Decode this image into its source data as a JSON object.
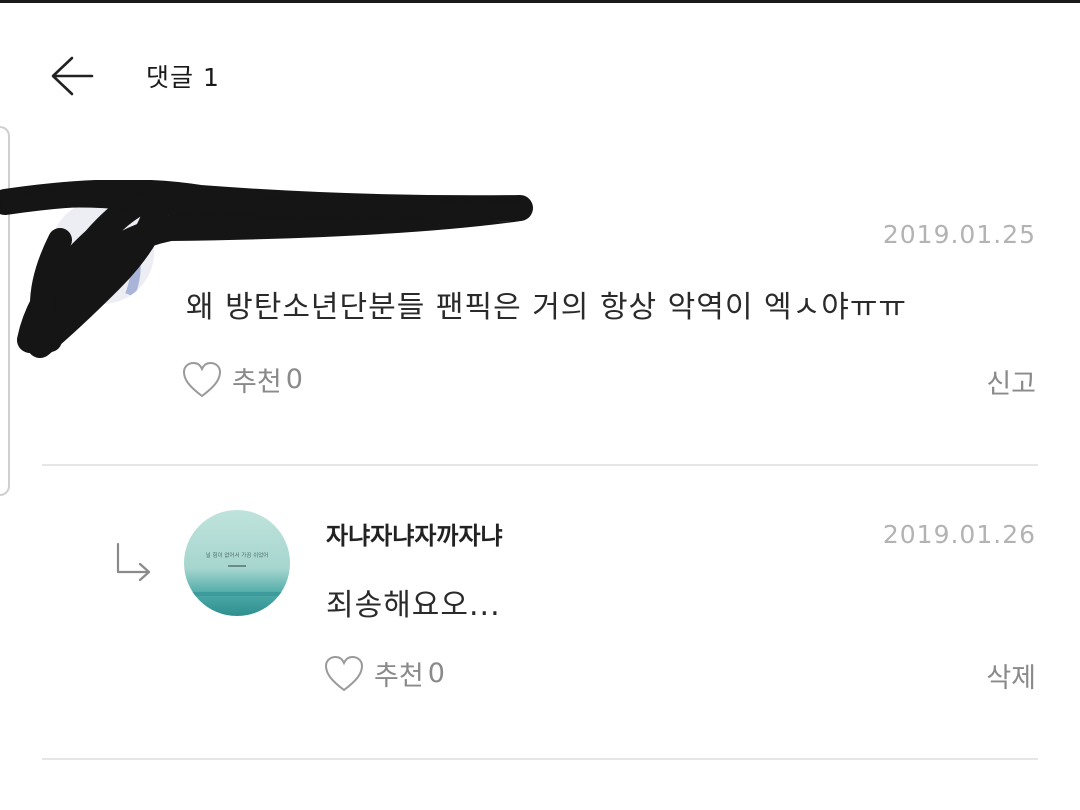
{
  "header": {
    "title": "댓글 1",
    "back_icon": "arrow-left-icon"
  },
  "comments": [
    {
      "author": "",
      "date": "2019.01.25",
      "text": "왜 방탄소년단분들 팬픽은 거의 항상 악역이 엑ㅅ야ㅠㅠ",
      "like_label": "추천",
      "like_count": "0",
      "action_label": "신고"
    }
  ],
  "reply": {
    "author": "자냐자냐자까자냐",
    "date": "2019.01.26",
    "text": "죄송해요오...",
    "like_label": "추천",
    "like_count": "0",
    "action_label": "삭제",
    "avatar_text": "널 힘이 없어서 가끔 쉬었어"
  },
  "colors": {
    "date": "#b3b3b3",
    "muted": "#8a8a8a",
    "divider": "#e6e6e6"
  }
}
